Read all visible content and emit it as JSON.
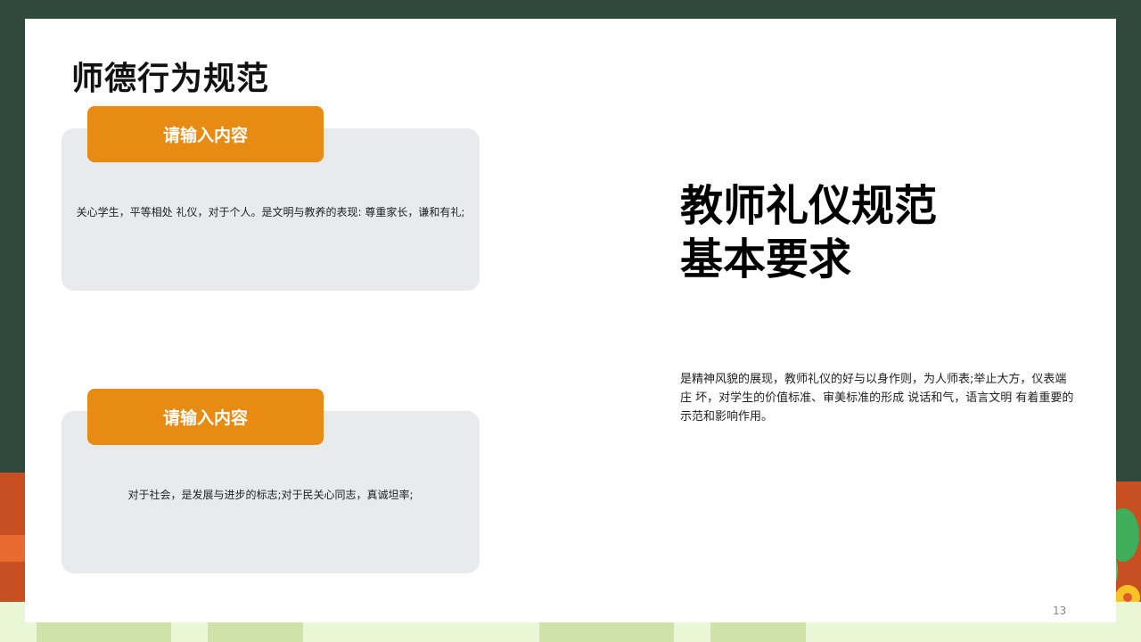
{
  "slide": {
    "title": "师德行为规范",
    "cards": [
      {
        "tab_label": "请输入内容",
        "text": "关心学生，平等相处 礼仪，对于个人。是文明与教养的表现: 尊重家长，谦和有礼;"
      },
      {
        "tab_label": "请输入内容",
        "text": "对于社会，是发展与进步的标志;对于民关心同志，真诚坦率;"
      }
    ],
    "right_title_line1": "教师礼仪规范",
    "right_title_line2": "基本要求",
    "right_body": "是精神风貌的展现，教师礼仪的好与以身作则，为人师表;举止大方，仪表端庄 坏，对学生的价值标准、审美标准的形成 说话和气，语言文明 有着重要的示范和影响作用。",
    "page_number": "13"
  },
  "colors": {
    "board": "#2f4a3c",
    "tab": "#e88b13",
    "card": "#e9eaec",
    "bottom_band": "#eaf7d6"
  }
}
